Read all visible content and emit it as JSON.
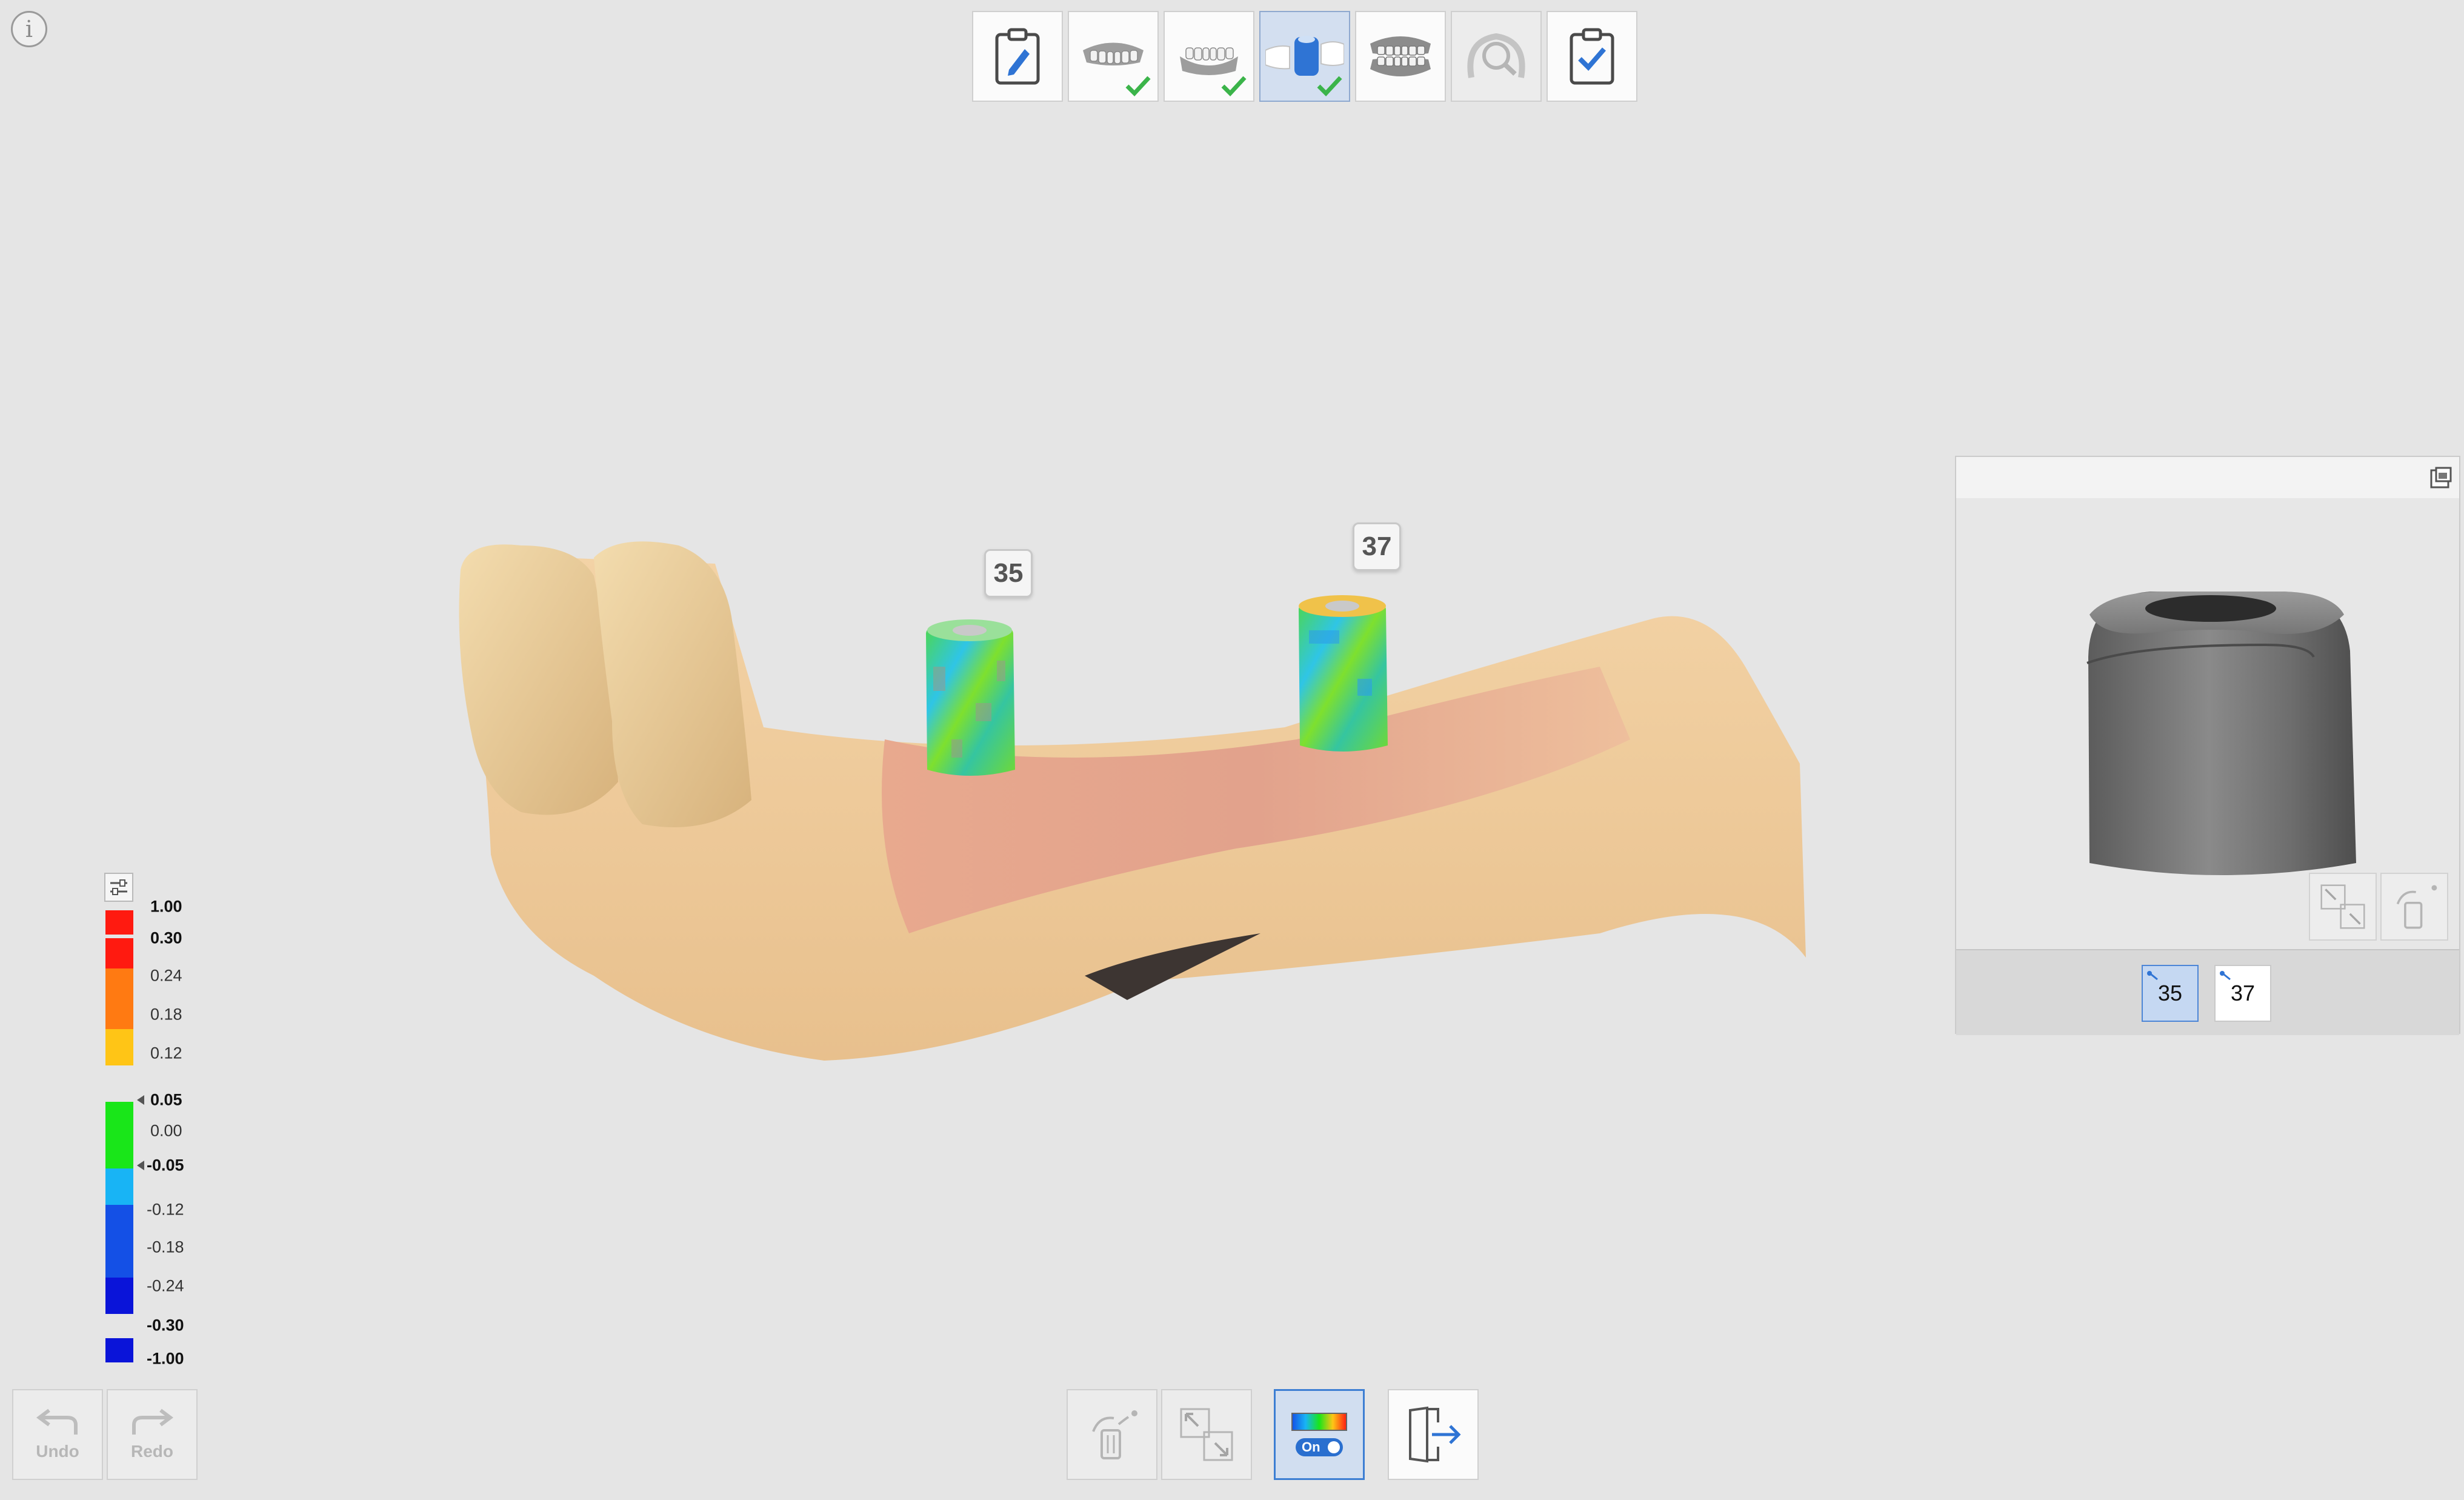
{
  "top_toolbar": {
    "steps": [
      {
        "name": "notes",
        "icon": "edit-clipboard-icon",
        "state": "normal",
        "checked": false
      },
      {
        "name": "upper-jaw",
        "icon": "upper-jaw-icon",
        "state": "normal",
        "checked": true
      },
      {
        "name": "lower-jaw",
        "icon": "lower-jaw-icon",
        "state": "normal",
        "checked": true
      },
      {
        "name": "scanbody",
        "icon": "scanbody-icon",
        "state": "active",
        "checked": true
      },
      {
        "name": "occlusion",
        "icon": "occlusion-icon",
        "state": "normal",
        "checked": false
      },
      {
        "name": "analysis",
        "icon": "jaw-magnify-icon",
        "state": "disabled",
        "checked": false
      },
      {
        "name": "complete",
        "icon": "check-clipboard-icon",
        "state": "normal",
        "checked": false
      }
    ]
  },
  "scene": {
    "tooth_labels": [
      "35",
      "37"
    ]
  },
  "legend": {
    "labels": [
      "1.00",
      "0.30",
      "0.24",
      "0.18",
      "0.12",
      "0.05",
      "0.00",
      "-0.05",
      "-0.12",
      "-0.18",
      "-0.24",
      "-0.30",
      "-1.00"
    ],
    "bold_labels": [
      "1.00",
      "0.30",
      "0.05",
      "-0.05",
      "-0.30",
      "-1.00"
    ],
    "colors": {
      "red": "#ff1a10",
      "orange": "#ff7a12",
      "yellow": "#ffc516",
      "green": "#19e619",
      "cyan": "#18b4f5",
      "blue": "#1450e6",
      "deep_blue": "#0a14d9"
    }
  },
  "history": {
    "undo_label": "Undo",
    "redo_label": "Redo"
  },
  "bottom_toolbar": {
    "color_map_toggle": "On"
  },
  "preview_panel": {
    "tabs": [
      {
        "label": "35",
        "selected": true
      },
      {
        "label": "37",
        "selected": false
      }
    ]
  }
}
